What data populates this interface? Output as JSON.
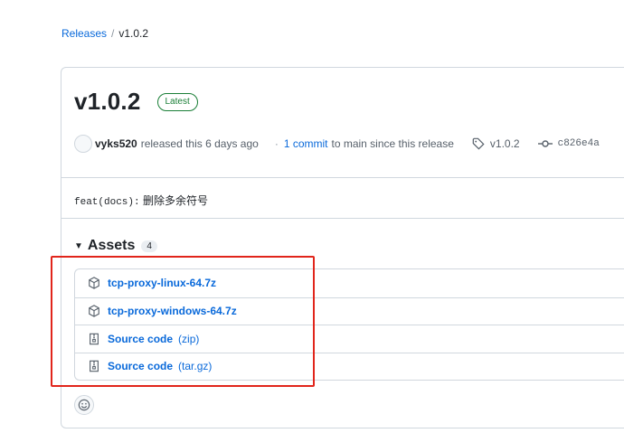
{
  "breadcrumb": {
    "parent": "Releases",
    "separator": "/",
    "current": "v1.0.2"
  },
  "release": {
    "title": "v1.0.2",
    "badge": "Latest",
    "author": "vyks520",
    "released_text": "released this 6 days ago",
    "commit_link": "1 commit",
    "commit_suffix": "to main since this release",
    "tag": "v1.0.2",
    "commit_hash": "c826e4a",
    "body_code": "feat(docs):",
    "body_text": "删除多余符号"
  },
  "assets": {
    "title": "Assets",
    "count": "4",
    "items": [
      {
        "name": "tcp-proxy-linux-64.7z",
        "ext": "",
        "icon": "package-icon"
      },
      {
        "name": "tcp-proxy-windows-64.7z",
        "ext": "",
        "icon": "package-icon"
      },
      {
        "name": "Source code",
        "ext": "(zip)",
        "icon": "file-zip-icon"
      },
      {
        "name": "Source code",
        "ext": "(tar.gz)",
        "icon": "file-zip-icon"
      }
    ]
  },
  "colors": {
    "link": "#0969da",
    "latest": "#1a7f37",
    "highlight": "#e1251b",
    "border": "#d0d7de"
  }
}
